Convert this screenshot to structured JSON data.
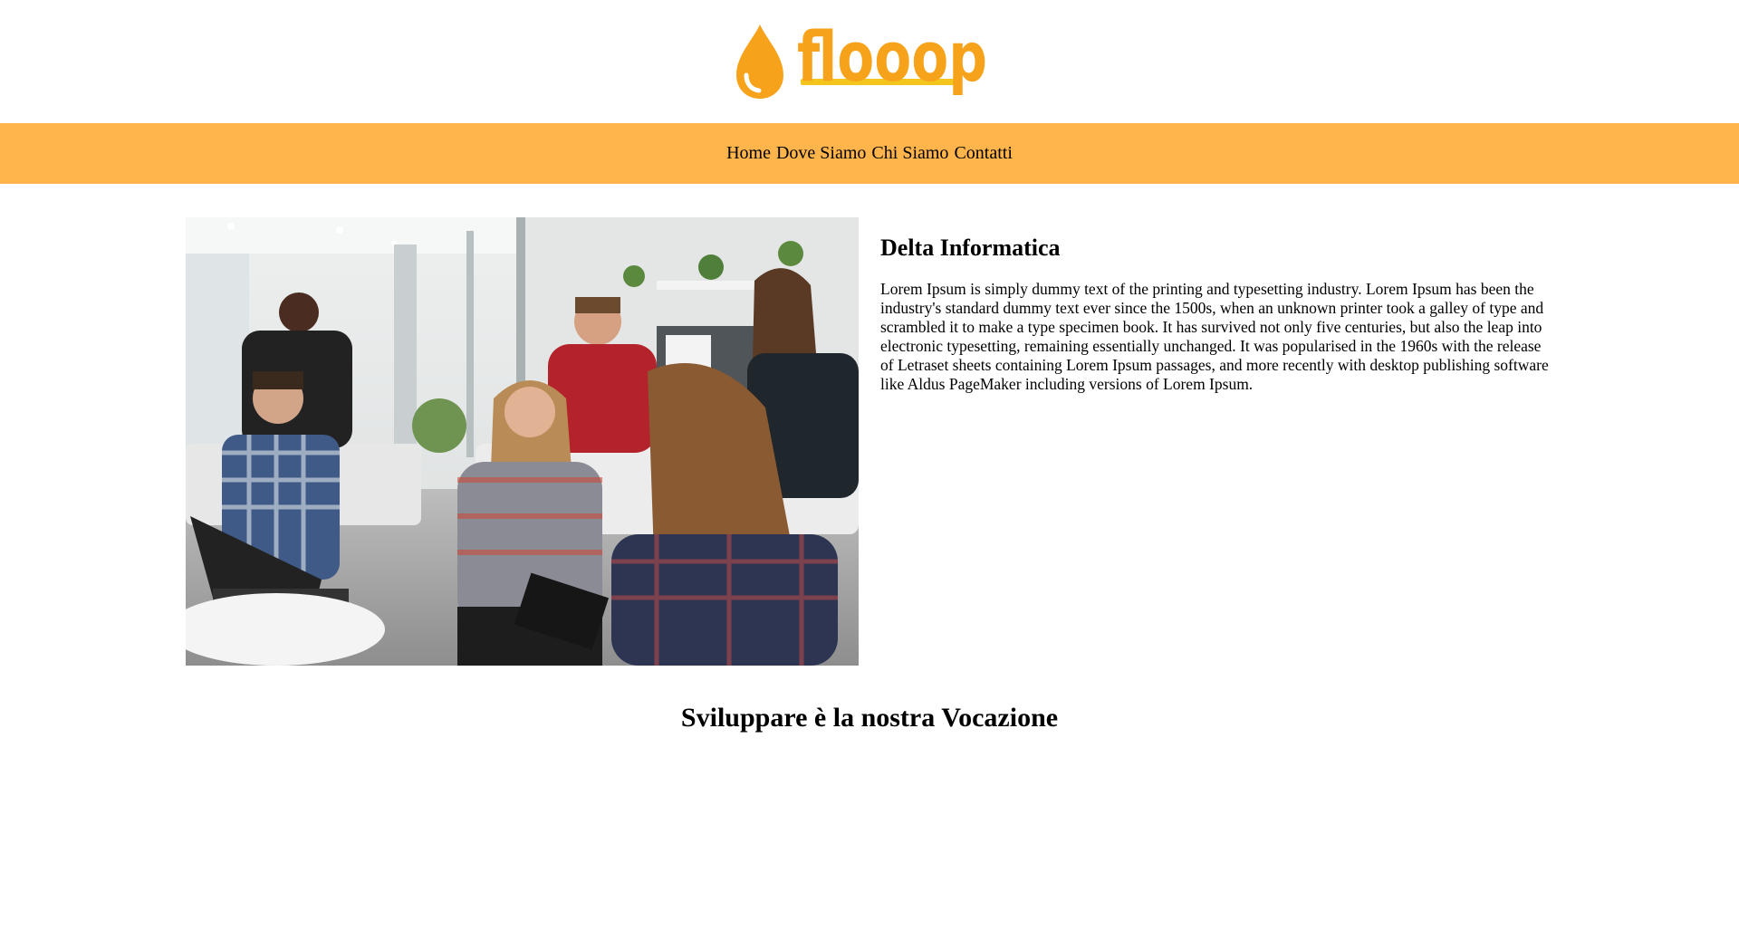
{
  "brand": {
    "name": "flooop",
    "color": "#f7a21b"
  },
  "nav": {
    "background": "#ffb54c",
    "items": [
      {
        "label": "Home"
      },
      {
        "label": "Dove Siamo"
      },
      {
        "label": "Chi Siamo"
      },
      {
        "label": "Contatti"
      }
    ]
  },
  "hero": {
    "image_icon": "team-meeting-photo"
  },
  "about": {
    "title": "Delta Informatica",
    "body": "Lorem Ipsum is simply dummy text of the printing and typesetting industry. Lorem Ipsum has been the industry's standard dummy text ever since the 1500s, when an unknown printer took a galley of type and scrambled it to make a type specimen book. It has survived not only five centuries, but also the leap into electronic typesetting, remaining essentially unchanged. It was popularised in the 1960s with the release of Letraset sheets containing Lorem Ipsum passages, and more recently with desktop publishing software like Aldus PageMaker including versions of Lorem Ipsum."
  },
  "tagline": "Sviluppare è la nostra Vocazione"
}
